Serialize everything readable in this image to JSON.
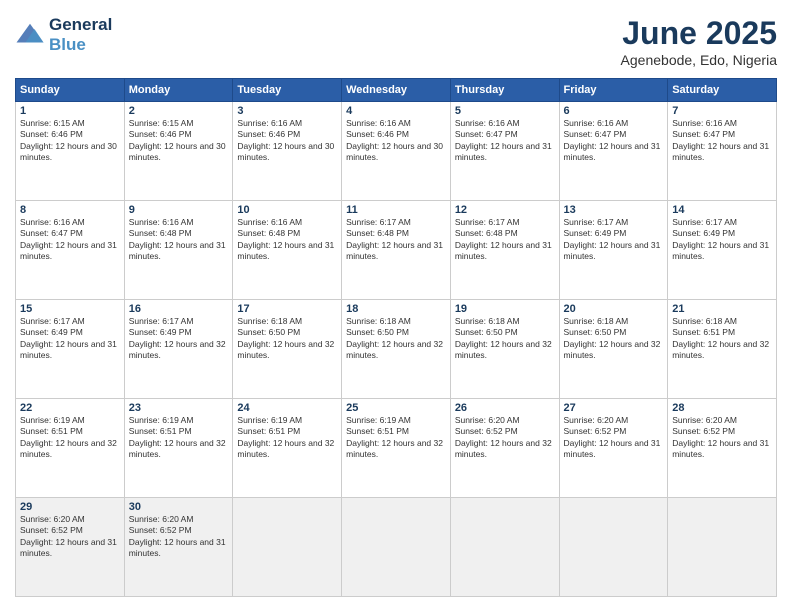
{
  "header": {
    "logo_line1": "General",
    "logo_line2": "Blue",
    "month": "June 2025",
    "location": "Agenebode, Edo, Nigeria"
  },
  "weekdays": [
    "Sunday",
    "Monday",
    "Tuesday",
    "Wednesday",
    "Thursday",
    "Friday",
    "Saturday"
  ],
  "weeks": [
    [
      {
        "day": "1",
        "sunrise": "6:15 AM",
        "sunset": "6:46 PM",
        "daylight": "12 hours and 30 minutes."
      },
      {
        "day": "2",
        "sunrise": "6:15 AM",
        "sunset": "6:46 PM",
        "daylight": "12 hours and 30 minutes."
      },
      {
        "day": "3",
        "sunrise": "6:16 AM",
        "sunset": "6:46 PM",
        "daylight": "12 hours and 30 minutes."
      },
      {
        "day": "4",
        "sunrise": "6:16 AM",
        "sunset": "6:46 PM",
        "daylight": "12 hours and 30 minutes."
      },
      {
        "day": "5",
        "sunrise": "6:16 AM",
        "sunset": "6:47 PM",
        "daylight": "12 hours and 31 minutes."
      },
      {
        "day": "6",
        "sunrise": "6:16 AM",
        "sunset": "6:47 PM",
        "daylight": "12 hours and 31 minutes."
      },
      {
        "day": "7",
        "sunrise": "6:16 AM",
        "sunset": "6:47 PM",
        "daylight": "12 hours and 31 minutes."
      }
    ],
    [
      {
        "day": "8",
        "sunrise": "6:16 AM",
        "sunset": "6:47 PM",
        "daylight": "12 hours and 31 minutes."
      },
      {
        "day": "9",
        "sunrise": "6:16 AM",
        "sunset": "6:48 PM",
        "daylight": "12 hours and 31 minutes."
      },
      {
        "day": "10",
        "sunrise": "6:16 AM",
        "sunset": "6:48 PM",
        "daylight": "12 hours and 31 minutes."
      },
      {
        "day": "11",
        "sunrise": "6:17 AM",
        "sunset": "6:48 PM",
        "daylight": "12 hours and 31 minutes."
      },
      {
        "day": "12",
        "sunrise": "6:17 AM",
        "sunset": "6:48 PM",
        "daylight": "12 hours and 31 minutes."
      },
      {
        "day": "13",
        "sunrise": "6:17 AM",
        "sunset": "6:49 PM",
        "daylight": "12 hours and 31 minutes."
      },
      {
        "day": "14",
        "sunrise": "6:17 AM",
        "sunset": "6:49 PM",
        "daylight": "12 hours and 31 minutes."
      }
    ],
    [
      {
        "day": "15",
        "sunrise": "6:17 AM",
        "sunset": "6:49 PM",
        "daylight": "12 hours and 31 minutes."
      },
      {
        "day": "16",
        "sunrise": "6:17 AM",
        "sunset": "6:49 PM",
        "daylight": "12 hours and 32 minutes."
      },
      {
        "day": "17",
        "sunrise": "6:18 AM",
        "sunset": "6:50 PM",
        "daylight": "12 hours and 32 minutes."
      },
      {
        "day": "18",
        "sunrise": "6:18 AM",
        "sunset": "6:50 PM",
        "daylight": "12 hours and 32 minutes."
      },
      {
        "day": "19",
        "sunrise": "6:18 AM",
        "sunset": "6:50 PM",
        "daylight": "12 hours and 32 minutes."
      },
      {
        "day": "20",
        "sunrise": "6:18 AM",
        "sunset": "6:50 PM",
        "daylight": "12 hours and 32 minutes."
      },
      {
        "day": "21",
        "sunrise": "6:18 AM",
        "sunset": "6:51 PM",
        "daylight": "12 hours and 32 minutes."
      }
    ],
    [
      {
        "day": "22",
        "sunrise": "6:19 AM",
        "sunset": "6:51 PM",
        "daylight": "12 hours and 32 minutes."
      },
      {
        "day": "23",
        "sunrise": "6:19 AM",
        "sunset": "6:51 PM",
        "daylight": "12 hours and 32 minutes."
      },
      {
        "day": "24",
        "sunrise": "6:19 AM",
        "sunset": "6:51 PM",
        "daylight": "12 hours and 32 minutes."
      },
      {
        "day": "25",
        "sunrise": "6:19 AM",
        "sunset": "6:51 PM",
        "daylight": "12 hours and 32 minutes."
      },
      {
        "day": "26",
        "sunrise": "6:20 AM",
        "sunset": "6:52 PM",
        "daylight": "12 hours and 32 minutes."
      },
      {
        "day": "27",
        "sunrise": "6:20 AM",
        "sunset": "6:52 PM",
        "daylight": "12 hours and 31 minutes."
      },
      {
        "day": "28",
        "sunrise": "6:20 AM",
        "sunset": "6:52 PM",
        "daylight": "12 hours and 31 minutes."
      }
    ],
    [
      {
        "day": "29",
        "sunrise": "6:20 AM",
        "sunset": "6:52 PM",
        "daylight": "12 hours and 31 minutes."
      },
      {
        "day": "30",
        "sunrise": "6:20 AM",
        "sunset": "6:52 PM",
        "daylight": "12 hours and 31 minutes."
      },
      null,
      null,
      null,
      null,
      null
    ]
  ],
  "labels": {
    "sunrise": "Sunrise:",
    "sunset": "Sunset:",
    "daylight": "Daylight:"
  }
}
